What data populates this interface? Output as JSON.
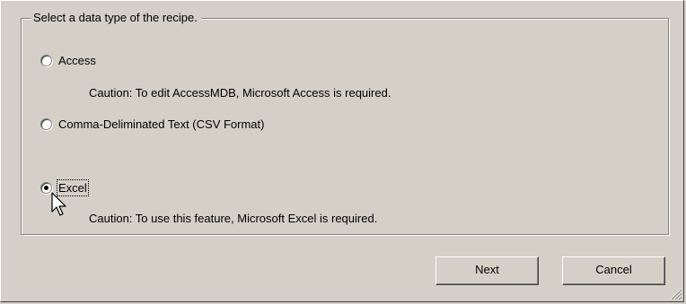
{
  "group": {
    "legend": "Select a data type of the recipe."
  },
  "options": [
    {
      "label": "Access",
      "checked": false
    },
    {
      "label": "Comma-Deliminated Text (CSV Format)",
      "checked": false
    },
    {
      "label": "Excel",
      "checked": true
    }
  ],
  "cautions": {
    "access": "Caution: To edit AccessMDB, Microsoft Access is required.",
    "excel": "Caution: To use this feature, Microsoft Excel is required."
  },
  "buttons": {
    "next": "Next",
    "cancel": "Cancel"
  },
  "icons": {
    "cursor": "arrow-pointer-icon",
    "grip": "resize-grip-icon"
  },
  "colors": {
    "face": "#d4d0c8",
    "shadow": "#808080",
    "highlight": "#ffffff"
  }
}
